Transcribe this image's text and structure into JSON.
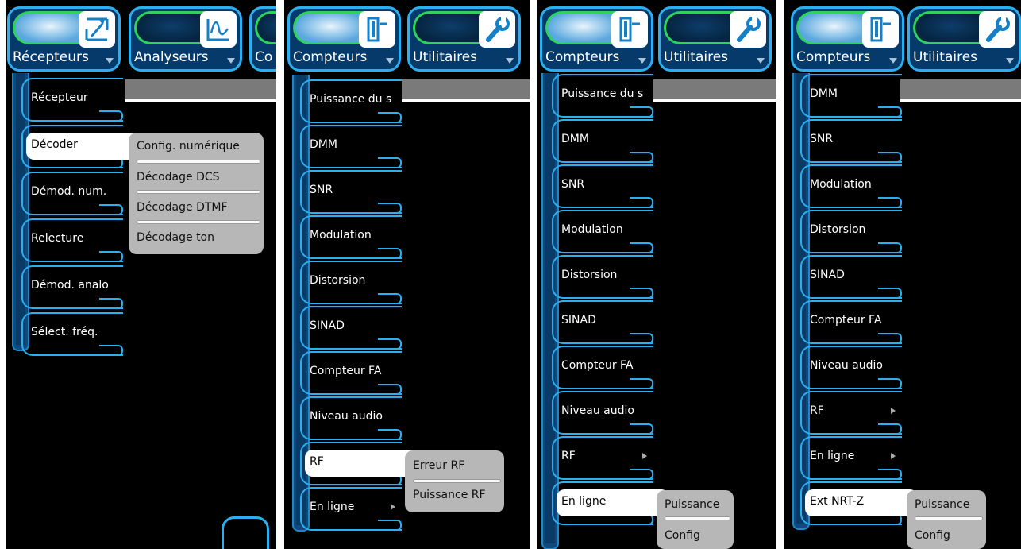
{
  "panel1": {
    "top_buttons": [
      {
        "label": "Récepteurs",
        "icon": "receivers-icon"
      },
      {
        "label": "Analyseurs",
        "icon": "analyzer-icon"
      },
      {
        "label": "Co",
        "icon": ""
      }
    ],
    "menu_items": [
      "Récepteur",
      "Décoder",
      "Démod. num.",
      "Relecture",
      "Démod. analo",
      "Sélect. fréq."
    ],
    "submenu": [
      "Config. numérique",
      "Décodage DCS",
      "Décodage DTMF",
      "Décodage ton"
    ]
  },
  "panel2": {
    "top_buttons": [
      {
        "label": "Compteurs",
        "icon": "meters-icon"
      },
      {
        "label": "Utilitaires",
        "icon": "wrench-icon"
      }
    ],
    "menu_items": [
      "Puissance du s",
      "DMM",
      "SNR",
      "Modulation",
      "Distorsion",
      "SINAD",
      "Compteur FA",
      "Niveau audio",
      "RF",
      "En ligne"
    ],
    "submenu": [
      "Erreur RF",
      "Puissance RF"
    ]
  },
  "panel3": {
    "top_buttons": [
      {
        "label": "Compteurs",
        "icon": "meters-icon"
      },
      {
        "label": "Utilitaires",
        "icon": "wrench-icon"
      }
    ],
    "menu_items": [
      "Puissance du s",
      "DMM",
      "SNR",
      "Modulation",
      "Distorsion",
      "SINAD",
      "Compteur FA",
      "Niveau audio",
      "RF",
      "En ligne"
    ],
    "submenu": [
      "Puissance",
      "Config"
    ]
  },
  "panel4": {
    "top_buttons": [
      {
        "label": "Compteurs",
        "icon": "meters-icon"
      },
      {
        "label": "Utilitaires",
        "icon": "wrench-icon"
      }
    ],
    "menu_items": [
      "DMM",
      "SNR",
      "Modulation",
      "Distorsion",
      "SINAD",
      "Compteur FA",
      "Niveau audio",
      "RF",
      "En ligne",
      "Ext NRT-Z"
    ],
    "submenu": [
      "Puissance",
      "Config"
    ]
  },
  "colors": {
    "accent": "#2ab0f0",
    "highlight": "#2ed35c",
    "submenu_bg": "#b7b7b7"
  }
}
